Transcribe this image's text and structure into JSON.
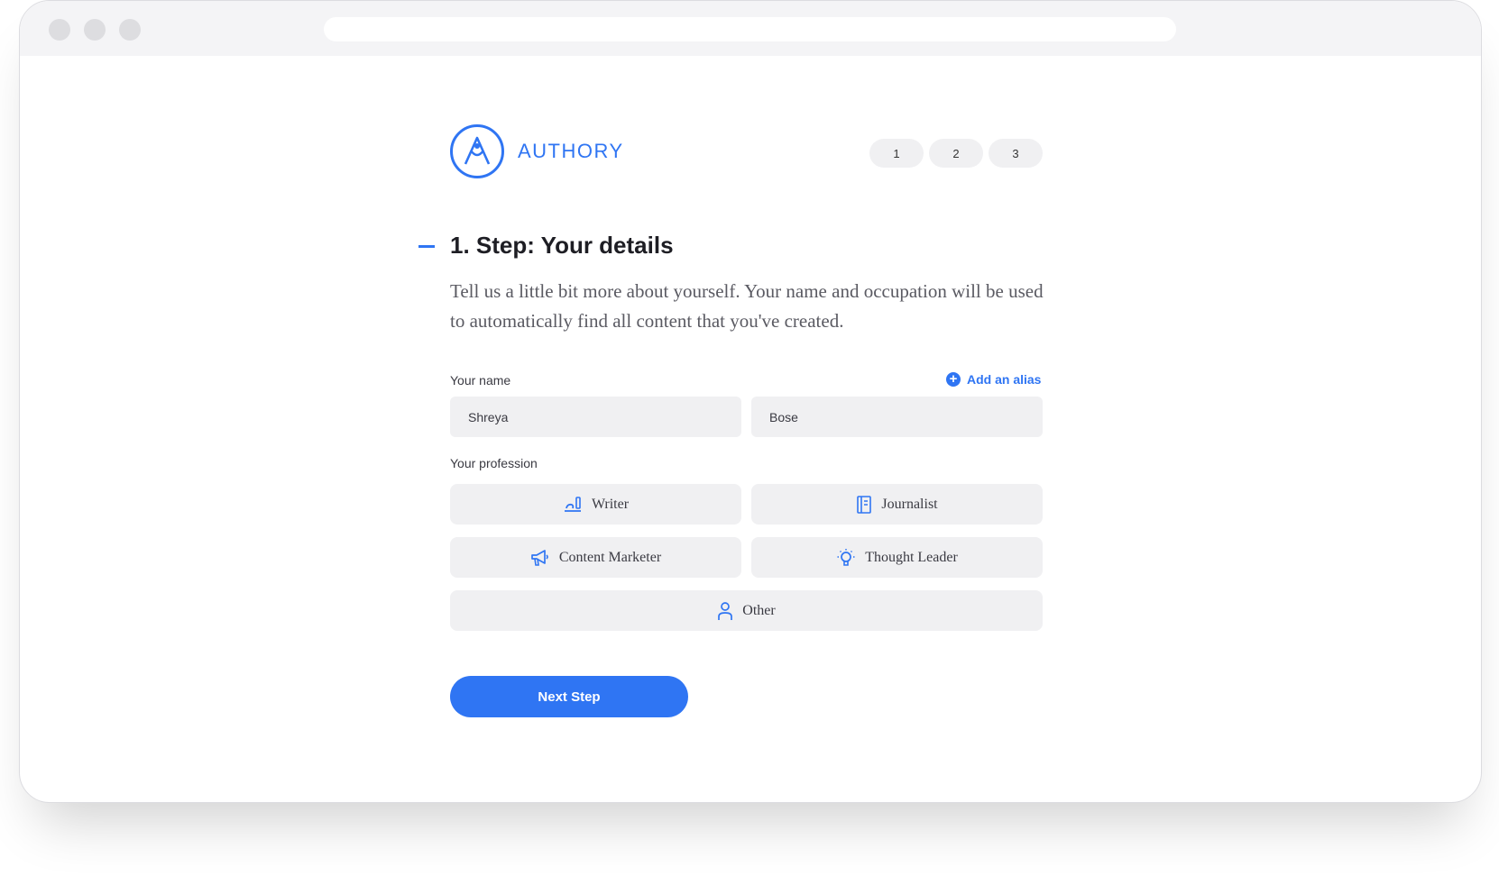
{
  "brand": {
    "name": "AUTHORY",
    "color": "#2f75f3"
  },
  "steps": [
    "1",
    "2",
    "3"
  ],
  "step": {
    "heading": "1. Step: Your details",
    "description": "Tell us a little bit more about yourself. Your name and occupation will be used to automatically find all content that you've created."
  },
  "name_section": {
    "label": "Your name",
    "add_alias_label": "Add an alias",
    "first_name": "Shreya",
    "last_name": "Bose"
  },
  "profession_section": {
    "label": "Your profession",
    "options": [
      {
        "label": "Writer",
        "icon": "writer-icon"
      },
      {
        "label": "Journalist",
        "icon": "journalist-icon"
      },
      {
        "label": "Content Marketer",
        "icon": "megaphone-icon"
      },
      {
        "label": "Thought Leader",
        "icon": "lightbulb-icon"
      },
      {
        "label": "Other",
        "icon": "person-icon"
      }
    ]
  },
  "next_button_label": "Next Step"
}
